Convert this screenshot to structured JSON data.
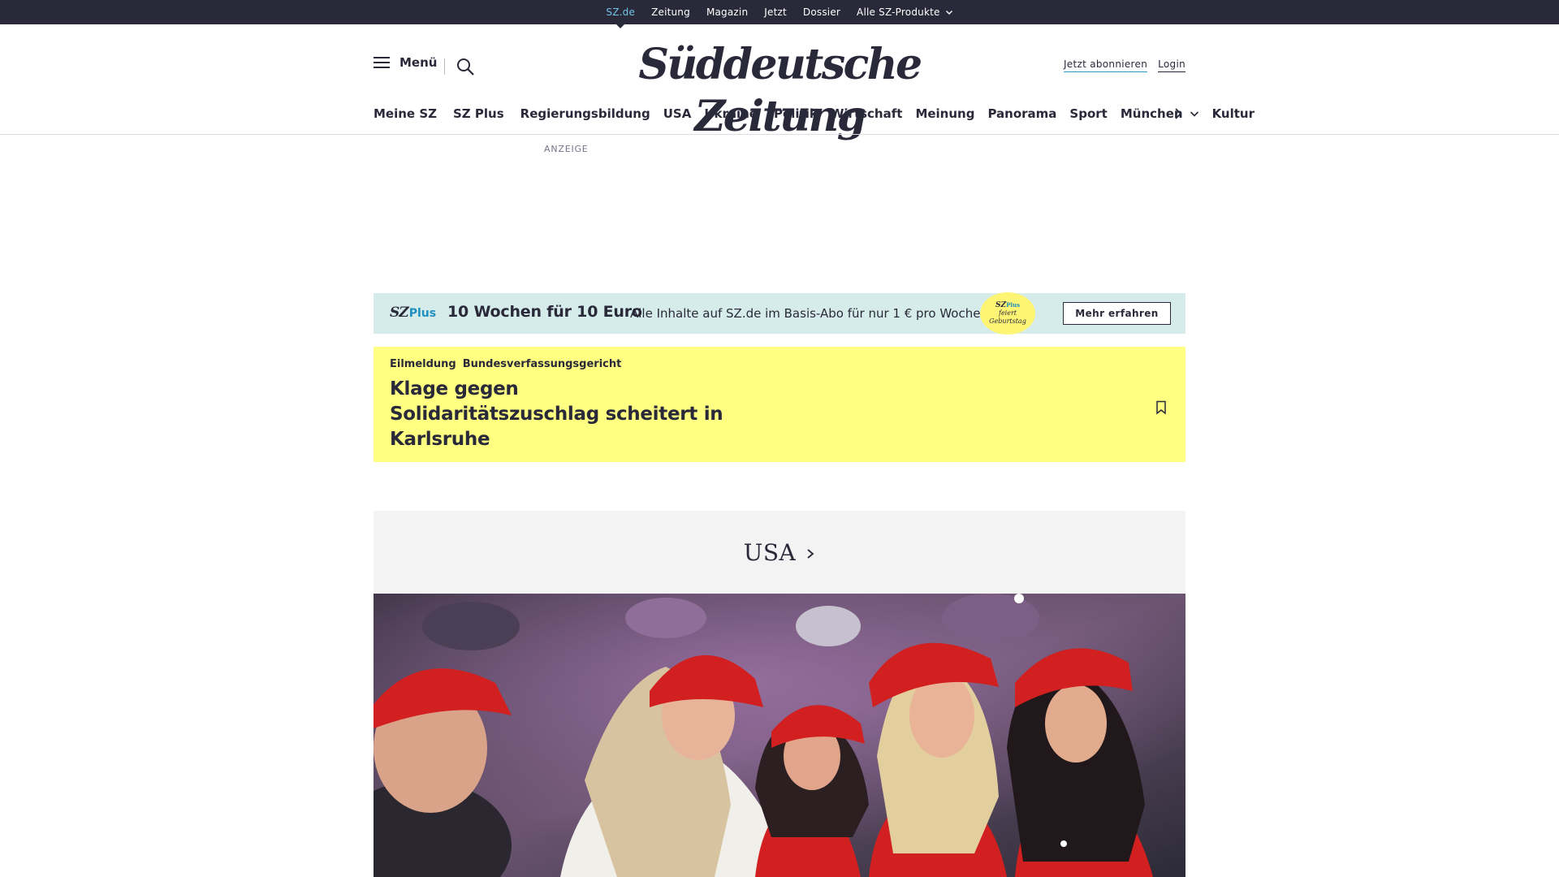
{
  "topbar": {
    "links": [
      "SZ.de",
      "Zeitung",
      "Magazin",
      "Jetzt",
      "Dossier",
      "Alle SZ-Produkte"
    ]
  },
  "header": {
    "menu_label": "Menü",
    "logo": "Süddeutsche Zeitung",
    "subscribe_label": "Jetzt abonnieren",
    "login_label": "Login"
  },
  "nav": {
    "items": [
      "Meine SZ",
      "SZ Plus",
      "Regierungsbildung",
      "USA",
      "Ukraine",
      "Politik",
      "Wirtschaft",
      "Meinung",
      "Panorama",
      "Sport",
      "München",
      "Kultur"
    ]
  },
  "ad": {
    "label": "ANZEIGE"
  },
  "promo": {
    "logo_sz": "SZ",
    "logo_plus": "Plus",
    "headline": "10 Wochen für 10 Euro",
    "text": "Alle Inhalte auf SZ.de im Basis-Abo für nur 1 € pro Woche.",
    "badge_sz": "SZ",
    "badge_plus": "Plus",
    "badge_line1": "feiert",
    "badge_line2": "Geburtstag",
    "button_label": "Mehr erfahren"
  },
  "breaking": {
    "kicker1": "Eilmeldung",
    "kicker2": "Bundesverfassungsgericht",
    "title": "Klage gegen Solidaritätszuschlag scheitert in Karlsruhe"
  },
  "section": {
    "label": "USA"
  },
  "colors": {
    "topbar_bg": "#29293a",
    "active_link": "#71c5e8",
    "promo_bg": "#d6ecea",
    "breaking_bg": "#ffff82",
    "section_bg": "#f3f3f3",
    "cap_red": "#d21f1f"
  }
}
